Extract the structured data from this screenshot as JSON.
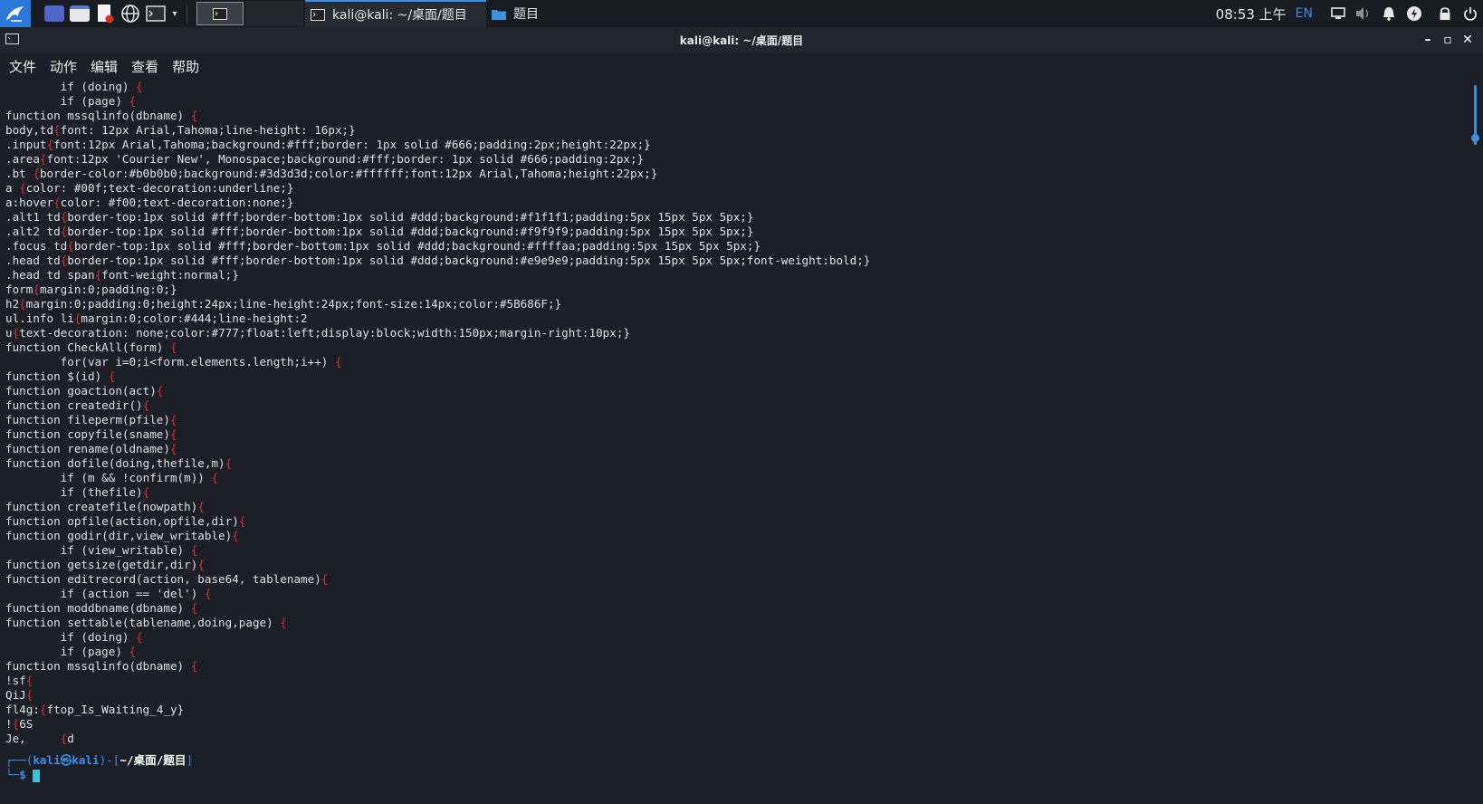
{
  "panel": {
    "tasks": [
      {
        "label": "kali@kali: ~/桌面/题目",
        "icon": "terminal-icon"
      },
      {
        "label": "题目",
        "icon": "folder-icon"
      }
    ],
    "clock": "08:53 上午",
    "lang": "EN"
  },
  "window": {
    "title": "kali@kali: ~/桌面/题目"
  },
  "menu": [
    "文件",
    "动作",
    "编辑",
    "查看",
    "帮助"
  ],
  "terminal": {
    "lines": [
      [
        "        if (doing) ",
        "{"
      ],
      [
        "        if (page) ",
        "{"
      ],
      [
        "function mssqlinfo(dbname) ",
        "{"
      ],
      [
        "body,td",
        "{",
        "font: 12px Arial,Tahoma;line-height: 16px;}"
      ],
      [
        ".input",
        "{",
        "font:12px Arial,Tahoma;background:#fff;border: 1px solid #666;padding:2px;height:22px;}"
      ],
      [
        ".area",
        "{",
        "font:12px 'Courier New', Monospace;background:#fff;border: 1px solid #666;padding:2px;}"
      ],
      [
        ".bt ",
        "{",
        "border-color:#b0b0b0;background:#3d3d3d;color:#ffffff;font:12px Arial,Tahoma;height:22px;}"
      ],
      [
        "a ",
        "{",
        "color: #00f;text-decoration:underline;}"
      ],
      [
        "a:hover",
        "{",
        "color: #f00;text-decoration:none;}"
      ],
      [
        ".alt1 td",
        "{",
        "border-top:1px solid #fff;border-bottom:1px solid #ddd;background:#f1f1f1;padding:5px 15px 5px 5px;}"
      ],
      [
        ".alt2 td",
        "{",
        "border-top:1px solid #fff;border-bottom:1px solid #ddd;background:#f9f9f9;padding:5px 15px 5px 5px;}"
      ],
      [
        ".focus td",
        "{",
        "border-top:1px solid #fff;border-bottom:1px solid #ddd;background:#ffffaa;padding:5px 15px 5px 5px;}"
      ],
      [
        ".head td",
        "{",
        "border-top:1px solid #fff;border-bottom:1px solid #ddd;background:#e9e9e9;padding:5px 15px 5px 5px;font-weight:bold;}"
      ],
      [
        ".head td span",
        "{",
        "font-weight:normal;}"
      ],
      [
        "form",
        "{",
        "margin:0;padding:0;}"
      ],
      [
        "h2",
        "{",
        "margin:0;padding:0;height:24px;line-height:24px;font-size:14px;color:#5B686F;}"
      ],
      [
        "ul.info li",
        "{",
        "margin:0;color:#444;line-height:2"
      ],
      [
        "u",
        "{",
        "text-decoration: none;color:#777;float:left;display:block;width:150px;margin-right:10px;}"
      ],
      [
        "function CheckAll(form) ",
        "{"
      ],
      [
        "        for(var i=0;i<form.elements.length;i++) ",
        "{"
      ],
      [
        "function $(id) ",
        "{"
      ],
      [
        "function goaction(act)",
        "{"
      ],
      [
        "function createdir()",
        "{"
      ],
      [
        "function fileperm(pfile)",
        "{"
      ],
      [
        "function copyfile(sname)",
        "{"
      ],
      [
        "function rename(oldname)",
        "{"
      ],
      [
        "function dofile(doing,thefile,m)",
        "{"
      ],
      [
        "        if (m && !confirm(m)) ",
        "{"
      ],
      [
        "        if (thefile)",
        "{"
      ],
      [
        "function createfile(nowpath)",
        "{"
      ],
      [
        "function opfile(action,opfile,dir)",
        "{"
      ],
      [
        "function godir(dir,view_writable)",
        "{"
      ],
      [
        "        if (view_writable) ",
        "{"
      ],
      [
        "function getsize(getdir,dir)",
        "{"
      ],
      [
        "function editrecord(action, base64, tablename)",
        "{"
      ],
      [
        "        if (action == 'del') ",
        "{"
      ],
      [
        "function moddbname(dbname) ",
        "{"
      ],
      [
        "function settable(tablename,doing,page) ",
        "{"
      ],
      [
        "        if (doing) ",
        "{"
      ],
      [
        "        if (page) ",
        "{"
      ],
      [
        "function mssqlinfo(dbname) ",
        "{"
      ],
      [
        "!sf",
        "{"
      ],
      [
        "QiJ",
        "{"
      ],
      [
        "fl4g:",
        "{",
        "ftop_Is_Waiting_4_y}"
      ],
      [
        "!",
        "{",
        "6S"
      ],
      [
        "Je,     ",
        "{",
        "d"
      ]
    ],
    "prompt": {
      "corner_top": "┌──(",
      "user": "kali㉿kali",
      "mid": ")-[",
      "path": "~/桌面/题目",
      "end": "]",
      "corner_bottom": "└─",
      "symbol": "$ "
    }
  },
  "colors": {
    "accent": "#3d8fe0",
    "brace": "#e32929",
    "background": "#1b1e27"
  }
}
